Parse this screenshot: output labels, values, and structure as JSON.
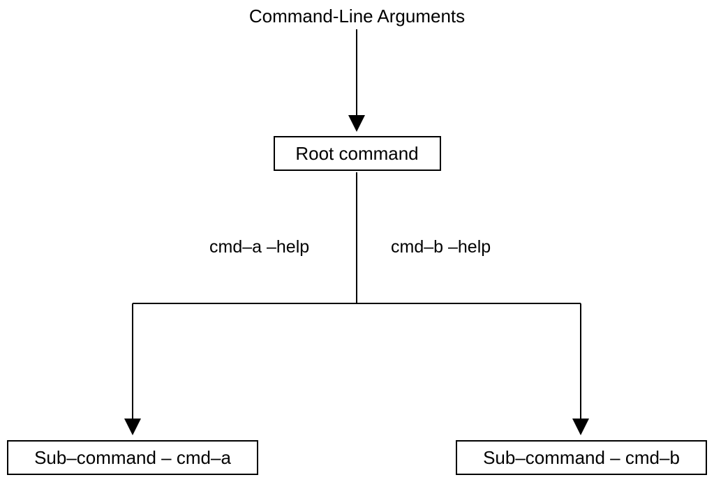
{
  "title": "Command-Line Arguments",
  "root": "Root command",
  "branch_a_label": "cmd–a –help",
  "branch_b_label": "cmd–b –help",
  "sub_a": "Sub–command – cmd–a",
  "sub_b": "Sub–command – cmd–b"
}
